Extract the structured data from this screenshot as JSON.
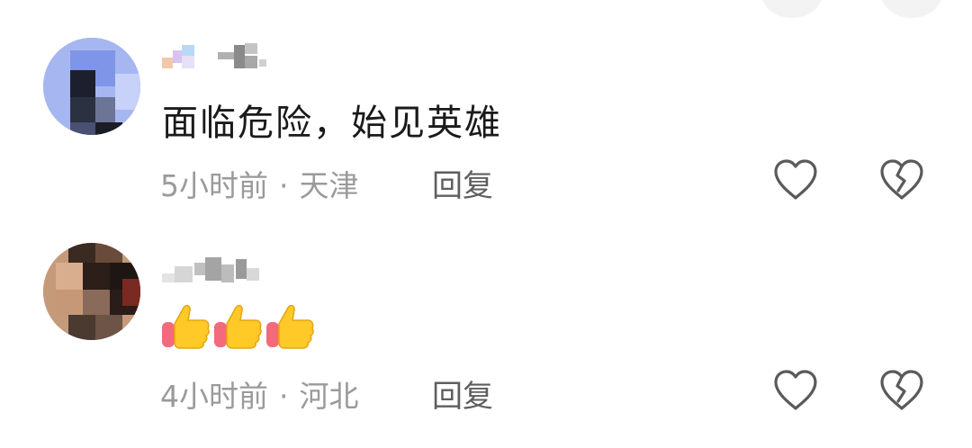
{
  "comments": [
    {
      "text": "面临危险，始见英雄",
      "time": "5小时前",
      "separator": "·",
      "location": "天津",
      "reply_label": "回复"
    },
    {
      "text": "",
      "emoji": [
        "thumbs-up",
        "thumbs-up",
        "thumbs-up"
      ],
      "time": "4小时前",
      "separator": "·",
      "location": "河北",
      "reply_label": "回复"
    }
  ],
  "icons": {
    "like": "heart-outline-icon",
    "dislike": "broken-heart-icon"
  },
  "colors": {
    "meta_text": "#9a9a9a",
    "reply_text": "#5e5e5e",
    "icon_stroke": "#5a5a5a"
  }
}
